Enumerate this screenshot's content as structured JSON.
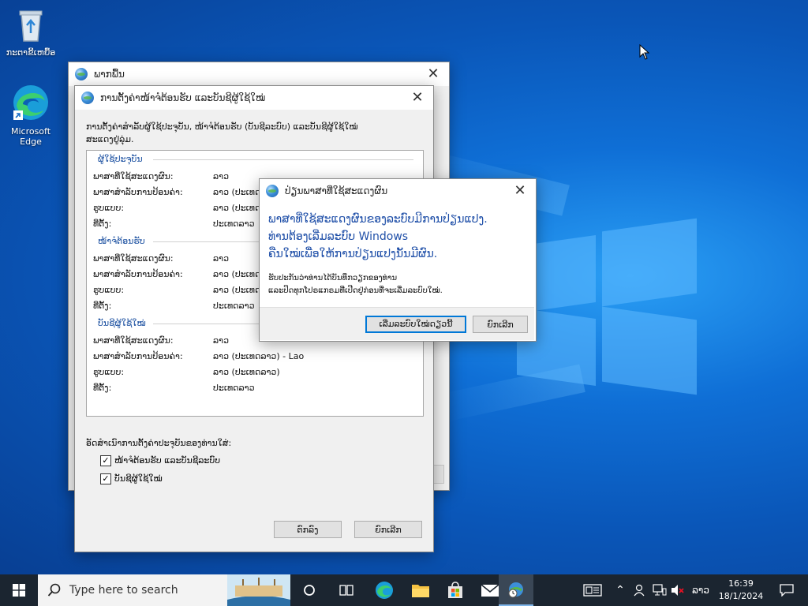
{
  "desktop": {
    "icons": [
      {
        "label": "ກະຕາຂີ້ເຫຍື້ອ",
        "icon": "recycle-bin-icon"
      },
      {
        "label": "Microsoft Edge",
        "icon": "edge-icon"
      }
    ]
  },
  "back_window": {
    "title": "ພາກພື້ນ"
  },
  "settings_dialog": {
    "title": "ການຕັ້ງຄ່າໜ້າຈໍຕ້ອນຮັບ ແລະບັນຊີຜູ້ໃຊ້ໃໝ່",
    "intro": "ການຕັ້ງຄ່າສຳລັບຜູ້ໃຊ້ປະຈຸບັນ, ໜ້າຈໍຕ້ອນຮັບ (ບັນຊີລະບົບ) ແລະບັນຊີຜູ້ໃຊ້ໃໝ່ ສະແດງຢູ່ລຸ່ມ.",
    "sections": [
      {
        "header": "ຜູ້ໃຊ້ປະຈຸບັນ",
        "rows": [
          {
            "label": "ພາສາທີ່ໃຊ້ສະແດງຜົນ:",
            "value": "ລາວ"
          },
          {
            "label": "ພາສາສຳລັບການປ້ອນຄ່າ:",
            "value": "ລາວ (ປະເທດ"
          },
          {
            "label": "ຮູບແບບ:",
            "value": "ລາວ (ປະເທດ"
          },
          {
            "label": "ທີ່ຕັ້ງ:",
            "value": "ປະເທດລາວ"
          }
        ]
      },
      {
        "header": "ໜ້າຈໍຕ້ອນຮັບ",
        "rows": [
          {
            "label": "ພາສາທີ່ໃຊ້ສະແດງຜົນ:",
            "value": "ລາວ"
          },
          {
            "label": "ພາສາສຳລັບການປ້ອນຄ່າ:",
            "value": "ລາວ (ປະເທດ"
          },
          {
            "label": "ຮູບແບບ:",
            "value": "ລາວ (ປະເທດ"
          },
          {
            "label": "ທີ່ຕັ້ງ:",
            "value": "ປະເທດລາວ"
          }
        ]
      },
      {
        "header": "ບັນຊີຜູ້ໃຊ້ໃໝ່",
        "rows": [
          {
            "label": "ພາສາທີ່ໃຊ້ສະແດງຜົນ:",
            "value": "ລາວ"
          },
          {
            "label": "ພາສາສຳລັບການປ້ອນຄ່າ:",
            "value": "ລາວ (ປະເທດລາວ) - Lao"
          },
          {
            "label": "ຮູບແບບ:",
            "value": "ລາວ (ປະເທດລາວ)"
          },
          {
            "label": "ທີ່ຕັ້ງ:",
            "value": "ປະເທດລາວ"
          }
        ]
      }
    ],
    "copy_label": "ອັດສຳເນົາການຕັ້ງຄ່າປະຈຸບັນຂອງທ່ານໃສ່:",
    "checkboxes": [
      {
        "label": "ໜ້າຈໍຕ້ອນຮັບ ແລະບັນຊີລະບົບ",
        "checked": true
      },
      {
        "label": "ບັນຊີຜູ້ໃຊ້ໃໝ່",
        "checked": true
      }
    ],
    "ok_label": "ຕົກລົງ",
    "cancel_label": "ຍົກເລີກ"
  },
  "restart_dialog": {
    "title": "ປ່ຽນພາສາທີ່ໃຊ້ສະແດງຜົນ",
    "main_lines": [
      "ພາສາທີ່ໃຊ້ສະແດງຜົນຂອງລະບົບມີການປ່ຽນແປງ.",
      "ທ່ານຕ້ອງເລີ່ມລະບົບ Windows",
      "ຄືນໃໝ່ເພື່ອໃຫ້ການປ່ຽນແປງນັ້ນມີຜົນ."
    ],
    "note_lines": [
      "ຮັບປະກັນວ່າທ່ານໄດ້ບັນທຶກວຽກຂອງທ່ານ",
      "ແລະປິດທຸກໂປຣແກຣມທີ່ເປີດຢູ່ກ່ອນທີ່ຈະເລີ່ມລະບົບໃໝ່."
    ],
    "restart_label": "ເລີ່ມລະບົບໃໝ່ດຽວນີ້",
    "cancel_label": "ຍົກເລີກ"
  },
  "taskbar": {
    "search_placeholder": "Type here to search",
    "language": "ລາວ",
    "time": "16:39",
    "date": "18/1/2024"
  },
  "colors": {
    "accent": "#0078d7",
    "instruction_text": "#1f4fa8",
    "taskbar": "#1b2530"
  }
}
